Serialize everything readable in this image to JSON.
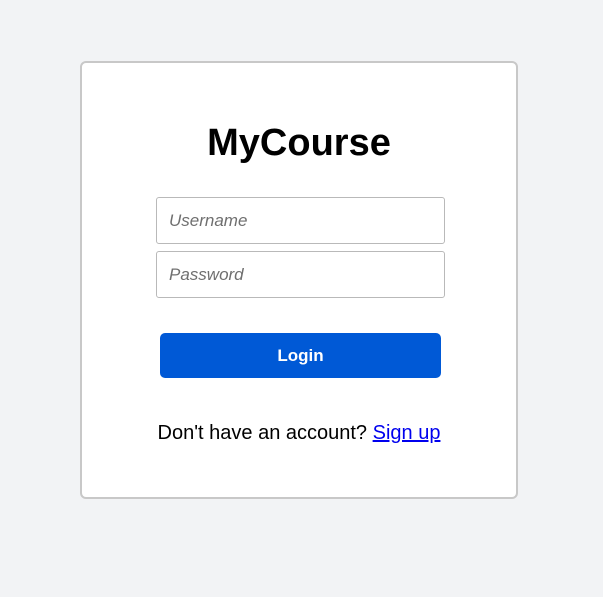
{
  "login_card": {
    "title": "MyCourse",
    "username": {
      "value": "",
      "placeholder": "Username"
    },
    "password": {
      "value": "",
      "placeholder": "Password"
    },
    "login_label": "Login",
    "signup_prompt": "Don't have an account? ",
    "signup_link": "Sign up"
  },
  "colors": {
    "background": "#f2f3f5",
    "card": "#ffffff",
    "button": "#0059d6",
    "link": "#0000ee"
  }
}
